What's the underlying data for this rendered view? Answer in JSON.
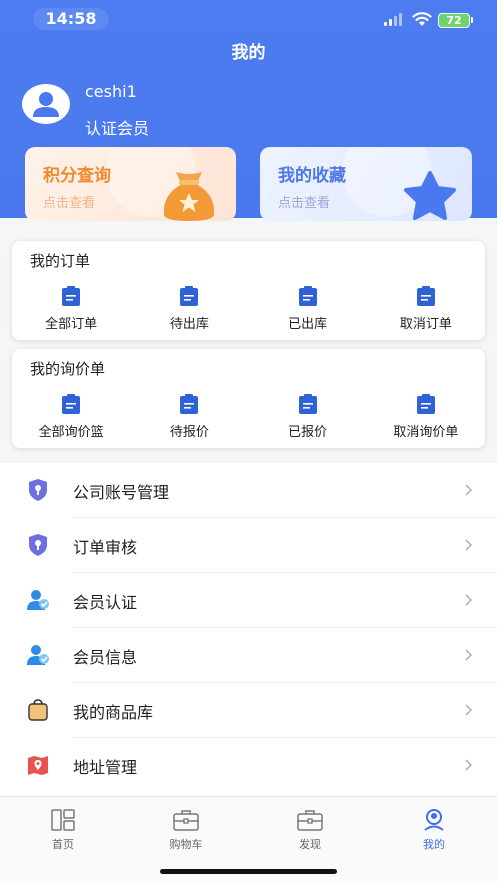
{
  "status_bar": {
    "time": "14:58",
    "battery": "72"
  },
  "header": {
    "title": "我的"
  },
  "user": {
    "name": "ceshi1",
    "level": "认证会员"
  },
  "promo_cards": [
    {
      "title": "积分查询",
      "subtitle": "点击查看",
      "icon": "money-bag-icon"
    },
    {
      "title": "我的收藏",
      "subtitle": "点击查看",
      "icon": "star-icon"
    }
  ],
  "orders": {
    "title": "我的订单",
    "items": [
      {
        "label": "全部订单",
        "icon": "clipboard-icon"
      },
      {
        "label": "待出库",
        "icon": "clipboard-icon"
      },
      {
        "label": "已出库",
        "icon": "clipboard-icon"
      },
      {
        "label": "取消订单",
        "icon": "clipboard-icon"
      }
    ]
  },
  "quotes": {
    "title": "我的询价单",
    "items": [
      {
        "label": "全部询价篮",
        "icon": "clipboard-icon"
      },
      {
        "label": "待报价",
        "icon": "clipboard-icon"
      },
      {
        "label": "已报价",
        "icon": "clipboard-icon"
      },
      {
        "label": "取消询价单",
        "icon": "clipboard-icon"
      }
    ]
  },
  "menu": [
    {
      "label": "公司账号管理",
      "icon": "shield-key-icon"
    },
    {
      "label": "订单审核",
      "icon": "shield-key-icon"
    },
    {
      "label": "会员认证",
      "icon": "member-icon"
    },
    {
      "label": "会员信息",
      "icon": "member-icon"
    },
    {
      "label": "我的商品库",
      "icon": "bag-icon"
    },
    {
      "label": "地址管理",
      "icon": "map-icon"
    }
  ],
  "tabbar": [
    {
      "label": "首页",
      "icon": "home-grid-icon",
      "active": false
    },
    {
      "label": "购物车",
      "icon": "briefcase-icon",
      "active": false
    },
    {
      "label": "发现",
      "icon": "briefcase-icon",
      "active": false
    },
    {
      "label": "我的",
      "icon": "profile-icon",
      "active": true
    }
  ],
  "colors": {
    "brand_blue": "#4a78ee",
    "clip_blue": "#2f62d6",
    "points_orange": "#f08a2c",
    "favs_blue": "#4d78e8"
  }
}
